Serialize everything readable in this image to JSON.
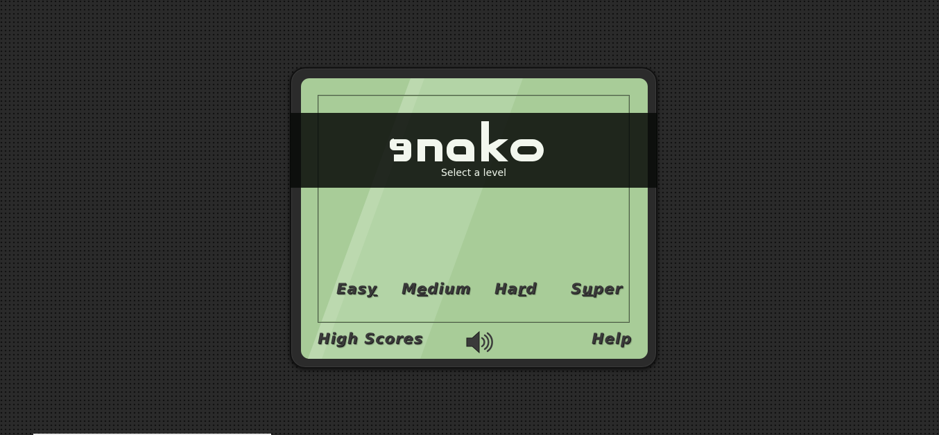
{
  "app": {
    "logo_text": "snake",
    "subtitle": "Select a level"
  },
  "levels": [
    {
      "label": "Easy",
      "hotkey": "y"
    },
    {
      "label": "Medium",
      "hotkey": "e"
    },
    {
      "label": "Hard",
      "hotkey": "r"
    },
    {
      "label": "Super",
      "hotkey": "u"
    }
  ],
  "footer": {
    "high_scores": "High Scores",
    "help": "Help",
    "sound_icon": "speaker-volume-icon"
  },
  "colors": {
    "screen": "#a8cc98",
    "band": "#0a0c0a",
    "bezel": "#2b2b2b",
    "button_text": "#3a3a3a"
  }
}
